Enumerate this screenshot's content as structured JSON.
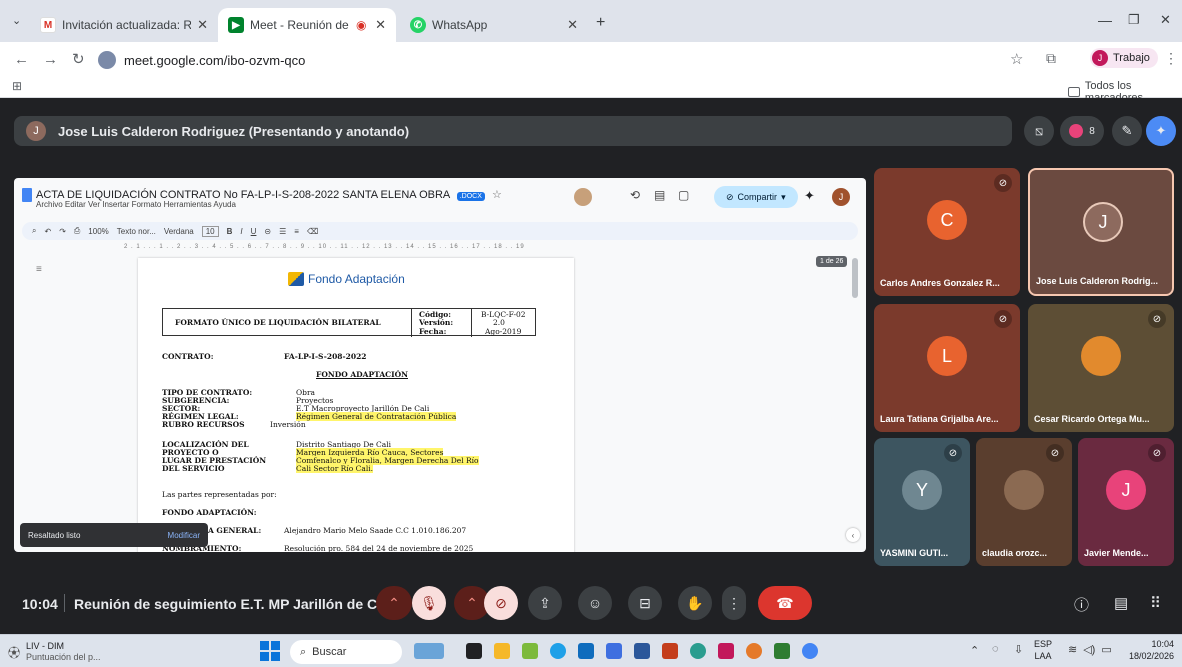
{
  "browser": {
    "tabs": [
      {
        "icon": "gmail-icon",
        "label": "Invitación actualizada: Reunión",
        "active": false
      },
      {
        "icon": "meet-icon",
        "label": "Meet - Reunión de seguimi",
        "active": true
      },
      {
        "icon": "whatsapp-icon",
        "label": "WhatsApp",
        "active": false
      }
    ],
    "url": "meet.google.com/ibo-ozvm-qco",
    "profile_label": "Trabajo",
    "profile_initial": "J",
    "bookmarks_folder": "Todos los marcadores"
  },
  "meet": {
    "presenter_initial": "J",
    "presenter_label": "Jose Luis Calderon Rodriguez (Presentando y anotando)",
    "participant_count": "8",
    "time": "10:04",
    "meeting_title": "Reunión de seguimiento E.T. MP Jarillón de Cali",
    "toast": {
      "text": "Resaltado listo",
      "action": "Modificar"
    },
    "participants": [
      {
        "initial": "C",
        "name": "Carlos Andres Gonzalez R...",
        "bg": "#7b3a2c",
        "avatar": "#e8632f",
        "muted": true
      },
      {
        "initial": "J",
        "name": "Jose Luis Calderon Rodrig...",
        "bg": "#6b4a40",
        "avatar": "#8d6a5e",
        "muted": false
      },
      {
        "initial": "L",
        "name": "Laura Tatiana Grijalba Are...",
        "bg": "#7b3a2c",
        "avatar": "#e8632f",
        "muted": true
      },
      {
        "initial": "",
        "name": "Cesar Ricardo Ortega Mu...",
        "bg": "#5d4e35",
        "avatar": "#e28a2d",
        "muted": true
      },
      {
        "initial": "Y",
        "name": "YASMINI GUTI...",
        "bg": "#3d5560",
        "avatar": "#6f8791",
        "muted": true
      },
      {
        "initial": "",
        "name": "claudia orozc...",
        "bg": "#5a3e2e",
        "avatar": "#8b6a52",
        "muted": true
      },
      {
        "initial": "J",
        "name": "Javier Mende...",
        "bg": "#6a2a40",
        "avatar": "#e8437a",
        "muted": true
      }
    ]
  },
  "doc": {
    "title": "ACTA DE LIQUIDACIÓN CONTRATO No FA-LP-I-S-208-2022 SANTA ELENA OBRA",
    "badge": ".DOCX",
    "menu": "Archivo  Editar  Ver  Insertar  Formato  Herramientas  Ayuda",
    "share": "Compartir",
    "toolbar": {
      "zoom": "100%",
      "style": "Texto nor...",
      "font": "Verdana",
      "size": "10"
    },
    "ruler": "2 . 1 . . . 1 . . 2 . . 3 . . 4 . . 5 . . 6 . . 7 . . 8 . . 9 . . 10 . . 11 . . 12 . . 13 . . 14 . . 15 . . 16 . . 17 . . 18 . . 19",
    "page_counter": "1 de 26",
    "logo": "Fondo Adaptación",
    "form_title": "FORMATO ÚNICO DE LIQUIDACIÓN BILATERAL",
    "codigo_label": "Código:",
    "codigo": "B-LQC-F-02",
    "version_label": "Versión:",
    "version": "2.0",
    "fecha_label": "Fecha:",
    "fecha": "Ago-2019",
    "contrato_label": "CONTRATO:",
    "contrato": "FA-LP-I-S-208-2022",
    "fondo": "FONDO ADAPTACIÓN",
    "tipo_label": "TIPO DE CONTRATO:",
    "tipo": "Obra",
    "subgerencia_label": "SUBGERENCIA:",
    "subgerencia": "Proyectos",
    "sector_label": "SECTOR:",
    "sector": "E.T Macroproyecto Jarillón De Cali",
    "regimen_label": "RÉGIMEN LEGAL:",
    "regimen": "Régimen General de Contratación Pública",
    "rubro_label": "RUBRO RECURSOS",
    "rubro": "Inversión",
    "loc_label1": "LOCALIZACIÓN DEL",
    "loc_label2": "PROYECTO O",
    "loc_label3": "LUGAR DE PRESTACIÓN",
    "loc_label4": "DEL SERVICIO",
    "loc1": "Distrito Santiago De Cali",
    "loc2": "Margen Izquierda Río Cauca, Sectores",
    "loc3": "Comfenalco y Floralia, Margen Derecha Del Río",
    "loc4": "Cali Sector Río Cali.",
    "partes": "Las partes representadas por:",
    "fondo2": "FONDO ADAPTACIÓN:",
    "gerente_label": "A GENERAL:",
    "gerente": "Alejandro Mario Melo Saade C.C 1.010.186.207",
    "nombramiento_label": "NOMBRAMIENTO:",
    "nombramiento": "Resolución pro. 584 del 24 de noviembre de 2025"
  },
  "taskbar": {
    "weather_title": "LIV - DIM",
    "weather_sub": "Puntuación del p...",
    "search": "Buscar",
    "lang1": "ESP",
    "lang2": "LAA",
    "time": "10:04",
    "date": "18/02/2026"
  }
}
